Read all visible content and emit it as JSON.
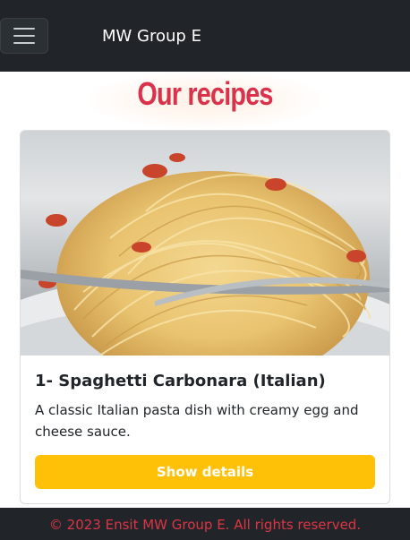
{
  "navbar": {
    "brand": "MW Group E",
    "toggler_icon": "hamburger-menu-icon"
  },
  "main": {
    "heading": "Our recipes"
  },
  "recipe_card": {
    "image_subject": "spaghetti-carbonara-photo",
    "title": "1- Spaghetti Carbonara (Italian)",
    "description": "A classic Italian pasta dish with creamy egg and cheese sauce.",
    "button_label": "Show details"
  },
  "footer": {
    "text": "© 2023 Ensit MW Group E. All rights reserved."
  },
  "colors": {
    "navbar_bg": "#212529",
    "heading": "#d9324a",
    "button_bg": "#ffc107",
    "footer_text": "#dc3545"
  }
}
